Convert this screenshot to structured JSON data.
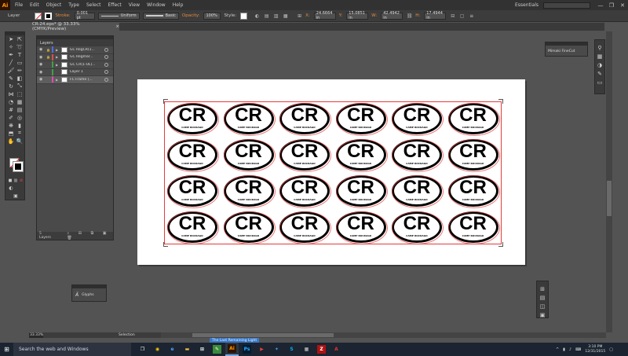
{
  "app": {
    "logo": "Ai",
    "menu": [
      "File",
      "Edit",
      "Object",
      "Type",
      "Select",
      "Effect",
      "View",
      "Window",
      "Help"
    ],
    "workspace": "Essentials",
    "win_controls": [
      "—",
      "❐",
      "✕"
    ]
  },
  "control_bar": {
    "selection_label": "Layer",
    "stroke_label": "Stroke:",
    "stroke_weight": "0.001 pt",
    "profile_label": "Uniform",
    "brush_label": "Basic",
    "opacity_label": "Opacity:",
    "opacity_value": "100%",
    "style_label": "Style:",
    "x_label": "X:",
    "x_value": "24.6664 in",
    "y_label": "Y:",
    "y_value": "15.0851 in",
    "w_label": "W:",
    "w_value": "42.4942 in",
    "h_label": "H:",
    "h_value": "17.4944 in"
  },
  "document": {
    "tab_title": "CR-24.eps* @ 33.33% (CMYK/Preview)",
    "tab_close": "×"
  },
  "layers_panel": {
    "title": "Layers",
    "layers": [
      {
        "name": "GC RegCR(1...",
        "color": "#4f6ede",
        "locked": true,
        "expanded": true,
        "selected": false
      },
      {
        "name": "GC Regmar...",
        "color": "#d94f4f",
        "locked": true,
        "expanded": true,
        "selected": false
      },
      {
        "name": "GC CR(1-UL)...",
        "color": "#3fa048",
        "locked": false,
        "expanded": true,
        "selected": false
      },
      {
        "name": "Layer 1",
        "color": "#3fa048",
        "locked": false,
        "expanded": false,
        "selected": false
      },
      {
        "name": "FC Frame (...",
        "color": "#d94fb0",
        "locked": false,
        "expanded": true,
        "selected": true
      }
    ],
    "footer_count": "5 Layers",
    "footer_icons": "⌕ ⊞ ⧉ ▣ 🗑"
  },
  "artwork": {
    "main_text": "CR",
    "caption": "CAMP ROCKAGO",
    "rows": 4,
    "cols": 6
  },
  "panels": {
    "mimaki": "Mimaki FineCut",
    "glyphs": "Glyphs",
    "glyphs_icon": "Ä"
  },
  "status": {
    "zoom": "33.33%",
    "tool": "Selection",
    "tooltip": "The Last Remaining Light"
  },
  "taskbar": {
    "search_placeholder": "Search the web and Windows",
    "time": "3:10 PM",
    "date": "12/31/2015",
    "apps": [
      {
        "name": "task-view",
        "label": "❐",
        "bg": "transparent",
        "fg": "#fff"
      },
      {
        "name": "chrome",
        "label": "◉",
        "bg": "transparent",
        "fg": "#f4c20d"
      },
      {
        "name": "edge",
        "label": "e",
        "bg": "transparent",
        "fg": "#4aa3ff"
      },
      {
        "name": "explorer",
        "label": "▬",
        "bg": "transparent",
        "fg": "#f0c040"
      },
      {
        "name": "store",
        "label": "⊞",
        "bg": "transparent",
        "fg": "#fff"
      },
      {
        "name": "sticky",
        "label": "✎",
        "bg": "#3a8a3a",
        "fg": "#fff"
      },
      {
        "name": "illustrator",
        "label": "Ai",
        "bg": "#2d1200",
        "fg": "#ff9a00",
        "active": true
      },
      {
        "name": "photoshop",
        "label": "Ps",
        "bg": "#001d34",
        "fg": "#31a8ff"
      },
      {
        "name": "media",
        "label": "▶",
        "bg": "transparent",
        "fg": "#e04040"
      },
      {
        "name": "dropbox",
        "label": "✦",
        "bg": "transparent",
        "fg": "#3d9ae8"
      },
      {
        "name": "skype",
        "label": "S",
        "bg": "transparent",
        "fg": "#00aff0"
      },
      {
        "name": "calculator",
        "label": "▦",
        "bg": "transparent",
        "fg": "#ccc"
      },
      {
        "name": "filezilla",
        "label": "Z",
        "bg": "#b01010",
        "fg": "#fff"
      },
      {
        "name": "acrobat",
        "label": "A",
        "bg": "transparent",
        "fg": "#e03030"
      }
    ]
  }
}
